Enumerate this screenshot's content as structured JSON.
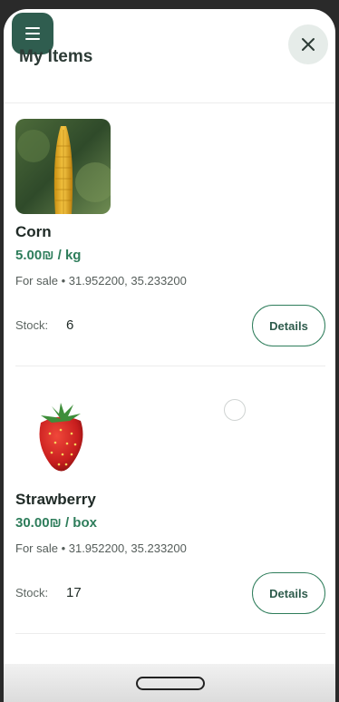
{
  "header": {
    "title": "My Items",
    "menu_icon": "menu-icon",
    "close_icon": "close-icon",
    "accent": "#2f5d4f"
  },
  "items": [
    {
      "name": "Corn",
      "price": "5.00₪ / kg",
      "meta": "For sale • 31.952200, 35.233200",
      "stock_label": "Stock:",
      "stock_value": "6",
      "details_label": "Details",
      "image": "corn-image"
    },
    {
      "name": "Strawberry",
      "price": "30.00₪ / box",
      "meta": "For sale • 31.952200, 35.233200",
      "stock_label": "Stock:",
      "stock_value": "17",
      "details_label": "Details",
      "image": "strawberry-image"
    }
  ],
  "colors": {
    "price_green": "#2e7d5b",
    "title_dark": "#2d3b36"
  }
}
